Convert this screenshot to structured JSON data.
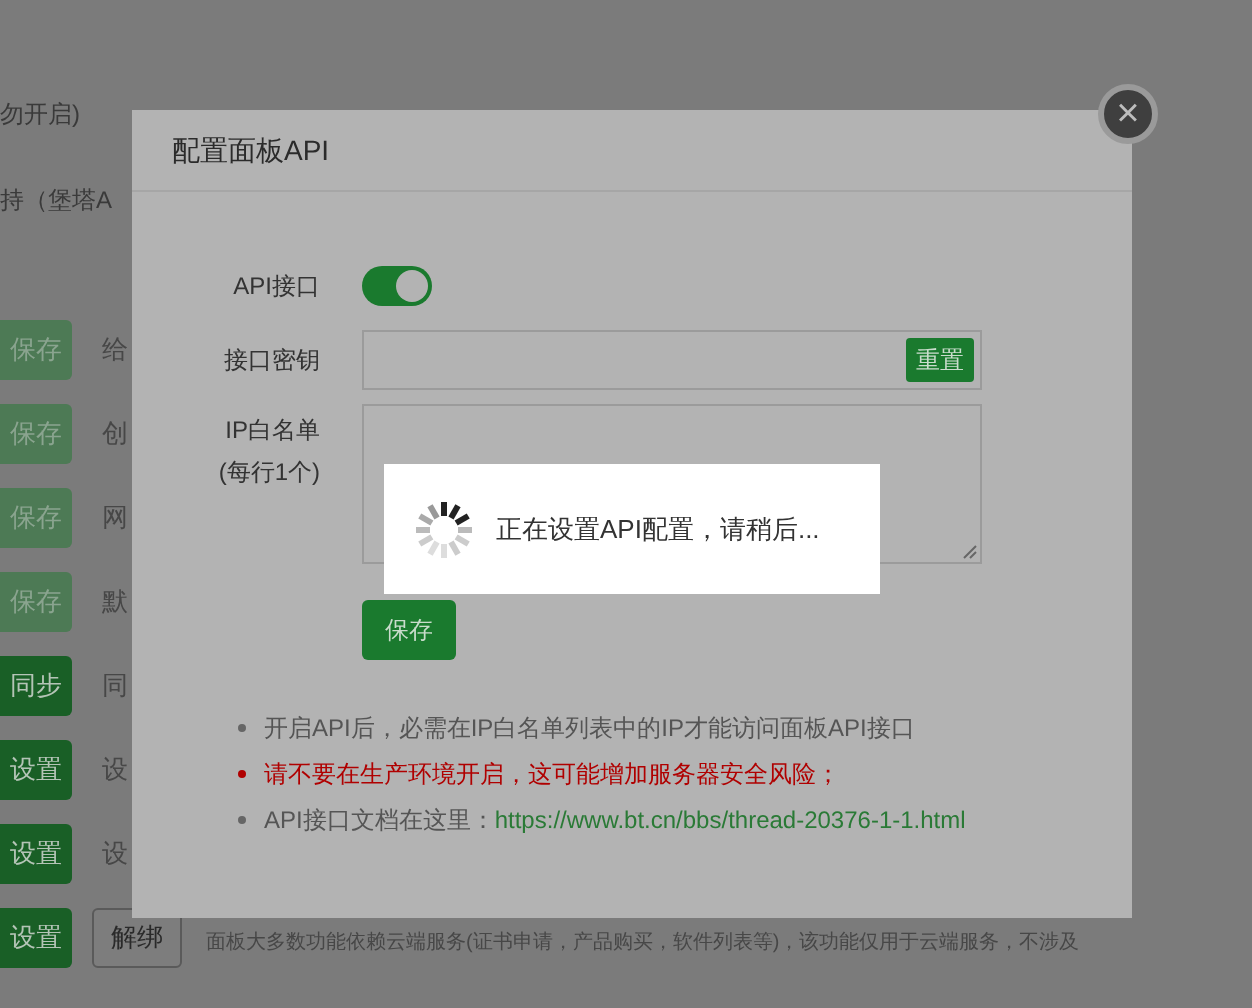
{
  "background": {
    "lines": [
      "勿开启)",
      "持（堡塔A"
    ],
    "rows": [
      {
        "button": "保存",
        "disabled": true,
        "label": "给"
      },
      {
        "button": "保存",
        "disabled": true,
        "label": "创"
      },
      {
        "button": "保存",
        "disabled": true,
        "label": "网"
      },
      {
        "button": "保存",
        "disabled": true,
        "label": "默"
      },
      {
        "button": "同步",
        "disabled": false,
        "label": "同"
      },
      {
        "button": "设置",
        "disabled": false,
        "label": "设"
      },
      {
        "button": "设置",
        "disabled": false,
        "label": "设"
      },
      {
        "button": "设置",
        "disabled": false,
        "extra_button": "解绑",
        "label": "面板大多数功能依赖云端服务(证书申请，产品购买，软件列表等)，该功能仅用于云端服务，不涉及"
      }
    ]
  },
  "dialog": {
    "title": "配置面板API",
    "close": "×",
    "api_toggle": {
      "label": "API接口",
      "on": true
    },
    "key_field": {
      "label": "接口密钥",
      "button": "重置"
    },
    "whitelist": {
      "label": "IP白名单",
      "hint": "(每行1个)"
    },
    "save": "保存",
    "notes": [
      {
        "text": "开启API后，必需在IP白名单列表中的IP才能访问面板API接口",
        "kind": "plain"
      },
      {
        "text": "请不要在生产环境开启，这可能增加服务器安全风险；",
        "kind": "warning"
      },
      {
        "text": "API接口文档在这里：",
        "kind": "link",
        "link": "https://www.bt.cn/bbs/thread-20376-1-1.html"
      }
    ]
  },
  "loading": {
    "message": "正在设置API配置，请稍后..."
  }
}
